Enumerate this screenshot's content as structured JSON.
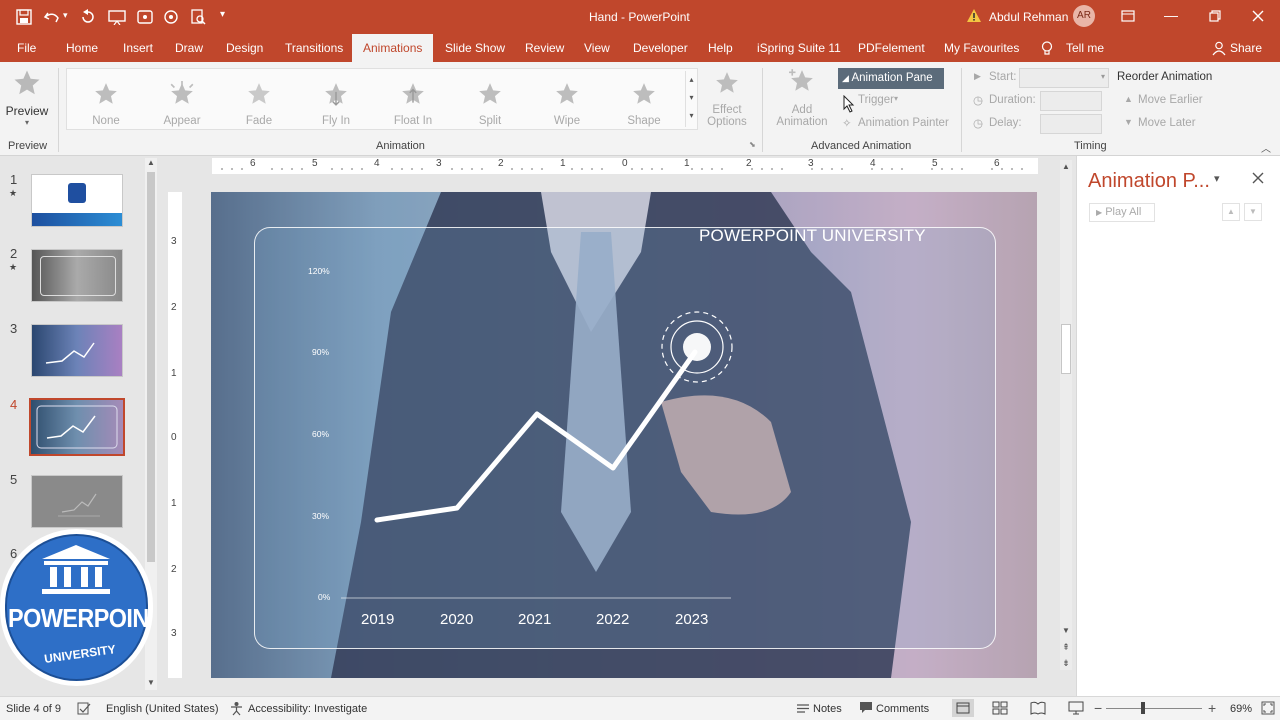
{
  "window": {
    "title": "Hand  -  PowerPoint",
    "user_name": "Abdul Rehman",
    "user_initials": "AR"
  },
  "tabs": [
    "File",
    "Home",
    "Insert",
    "Draw",
    "Design",
    "Transitions",
    "Animations",
    "Slide Show",
    "Review",
    "View",
    "Developer",
    "Help",
    "iSpring Suite 11",
    "PDFelement",
    "My Favourites",
    "Tell me",
    "Share"
  ],
  "ribbon": {
    "preview": {
      "label": "Preview",
      "group": "Preview"
    },
    "animation_group": "Animation",
    "gallery": [
      "None",
      "Appear",
      "Fade",
      "Fly In",
      "Float In",
      "Split",
      "Wipe",
      "Shape"
    ],
    "effect_options": [
      "Effect",
      "Options"
    ],
    "add_animation": [
      "Add",
      "Animation"
    ],
    "animation_pane": "Animation Pane",
    "trigger": "Trigger",
    "animation_painter": "Animation Painter",
    "advanced_group": "Advanced Animation",
    "start": "Start:",
    "duration": "Duration:",
    "delay": "Delay:",
    "reorder": "Reorder Animation",
    "move_earlier": "Move Earlier",
    "move_later": "Move Later",
    "timing_group": "Timing"
  },
  "ruler_top": [
    "6",
    "5",
    "4",
    "3",
    "2",
    "1",
    "0",
    "1",
    "2",
    "3",
    "4",
    "5",
    "6"
  ],
  "ruler_left": [
    "3",
    "2",
    "1",
    "0",
    "1",
    "2",
    "3"
  ],
  "thumbnails": [
    "1",
    "2",
    "3",
    "4",
    "5",
    "6"
  ],
  "slide": {
    "heading": "POWERPOINT UNIVERSITY",
    "y_labels": [
      "120%",
      "90%",
      "60%",
      "30%",
      "0%"
    ],
    "x_labels": [
      "2019",
      "2020",
      "2021",
      "2022",
      "2023"
    ]
  },
  "logo": {
    "line1": "POWERPOINT",
    "line2": "UNIVERSITY"
  },
  "animation_pane": {
    "title": "Animation P...",
    "play_all": "Play All"
  },
  "status": {
    "slide": "Slide 4 of 9",
    "language": "English (United States)",
    "accessibility": "Accessibility: Investigate",
    "notes": "Notes",
    "comments": "Comments",
    "zoom": "69%"
  },
  "colors": {
    "accent": "#c0472c",
    "ribbon": "#f3f3f3",
    "logo_blue": "#2e6fc7"
  }
}
